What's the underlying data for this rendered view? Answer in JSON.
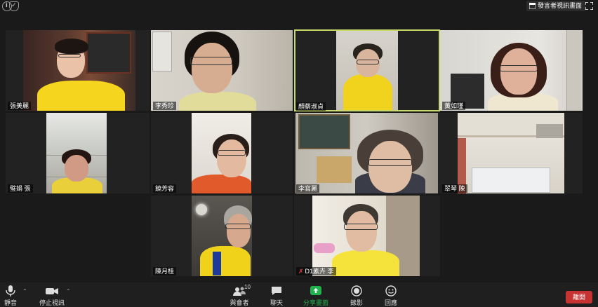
{
  "topbar": {
    "speaker_view_label": "發言者視訊畫面",
    "icons": [
      "info-icon",
      "shield-icon",
      "speaker-view-icon",
      "fullscreen-icon"
    ]
  },
  "participants": [
    {
      "name": "張美麗",
      "active": false
    },
    {
      "name": "李秀珍",
      "active": false
    },
    {
      "name": "顏蔡淑貞",
      "active": true
    },
    {
      "name": "黃如瑾",
      "active": false
    },
    {
      "name": "璧娟 張",
      "active": false
    },
    {
      "name": "饒芳容",
      "active": false
    },
    {
      "name": "李寫麗",
      "active": false
    },
    {
      "name": "翠琴 陳",
      "active": false
    },
    {
      "name": "陳月桂",
      "active": false
    },
    {
      "name": "D1素卉 李",
      "active": false,
      "muted": true
    }
  ],
  "toolbar": {
    "mute_label": "靜音",
    "video_label": "停止視訊",
    "participants_label": "與會者",
    "participants_count": "10",
    "chat_label": "聊天",
    "share_label": "分享畫面",
    "record_label": "錄影",
    "reactions_label": "回應",
    "end_label": "離開"
  },
  "colors": {
    "background": "#1a1a1a",
    "active_speaker_border": "#c7d96b",
    "share_green": "#23b14d",
    "end_red": "#c73232",
    "uniform_yellow": "#f5d51e"
  }
}
